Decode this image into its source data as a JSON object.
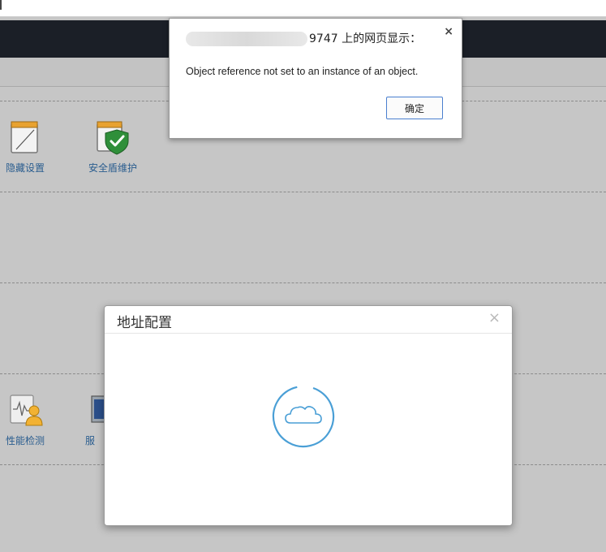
{
  "alert": {
    "title_visible_suffix": "9747 上的网页显示：",
    "close_glyph": "×",
    "message": "Object reference not set to an instance of an object.",
    "ok_label": "确定"
  },
  "tools": [
    {
      "label": "隐藏设置",
      "icon": "notepad-icon"
    },
    {
      "label": "安全盾维护",
      "icon": "shield-check-icon"
    },
    {
      "label": "性能检测",
      "icon": "performance-user-icon"
    },
    {
      "label": "服",
      "icon": "monitor-icon"
    }
  ],
  "modal": {
    "title": "地址配置",
    "close_glyph": "×",
    "loading_icon": "cloud-loading-icon"
  },
  "colors": {
    "header_bg": "#1b1f27",
    "page_bg": "#c6c6c6",
    "link_blue": "#2a5d8f",
    "spinner_blue": "#4a9fd6"
  }
}
